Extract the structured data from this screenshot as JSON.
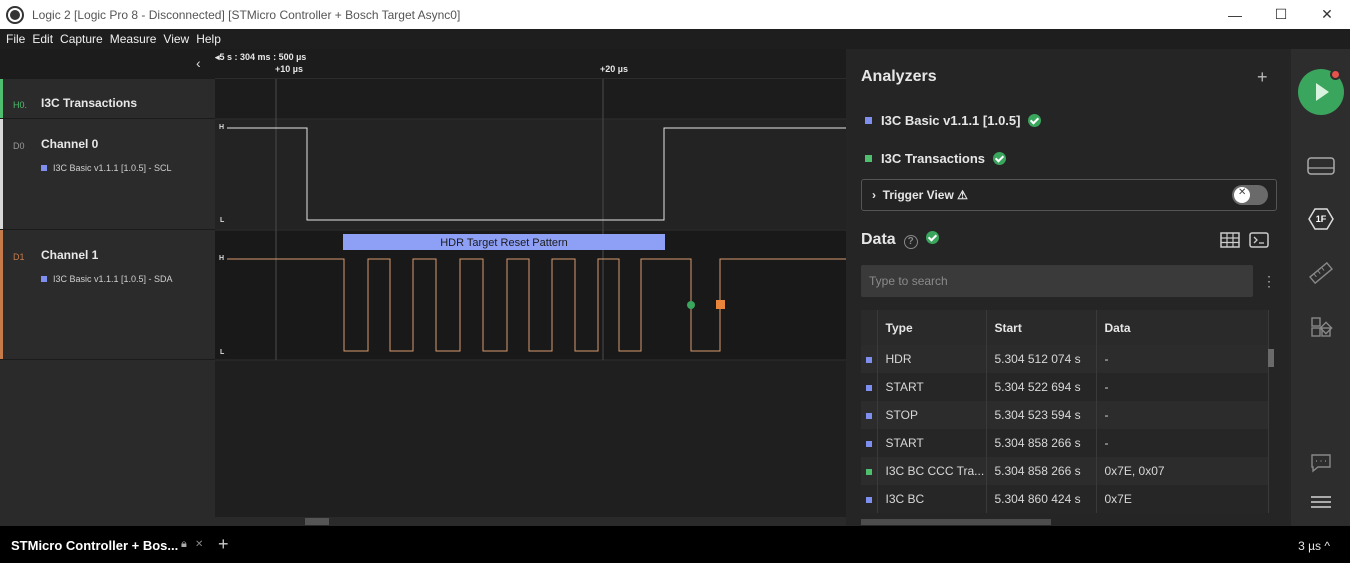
{
  "window": {
    "title": "Logic 2 [Logic Pro 8 - Disconnected] [STMicro Controller + Bosch Target Async0]",
    "minimize": "—",
    "maximize": "☐",
    "close": "✕"
  },
  "menu": [
    "File",
    "Edit",
    "Capture",
    "Measure",
    "View",
    "Help"
  ],
  "ruler": {
    "absolute": "5 s : 304 ms : 500 µs",
    "tick1": "+10 µs",
    "tick2": "+20 µs"
  },
  "channels": [
    {
      "tag": "H0.",
      "name": "I3C Transactions",
      "color": "#4fbf6f"
    },
    {
      "tag": "D0",
      "name": "Channel 0",
      "sub": "I3C Basic v1.1.1 [1.0.5] - SCL",
      "color": "#d8d8d8",
      "high": "H",
      "low": "L"
    },
    {
      "tag": "D1",
      "name": "Channel 1",
      "sub": "I3C Basic v1.1.1 [1.0.5] - SDA",
      "color": "#c77b4a",
      "high": "H",
      "low": "L"
    }
  ],
  "annotation": "HDR Target Reset Pattern",
  "analyzers": {
    "title": "Analyzers",
    "add": "+",
    "items": [
      {
        "name": "I3C Basic v1.1.1 [1.0.5]",
        "color": "#7f8ff0"
      },
      {
        "name": "I3C Transactions",
        "color": "#4fbf6f"
      }
    ],
    "trigger_view": "Trigger View",
    "warning": "⚠"
  },
  "data_panel": {
    "title": "Data",
    "help": "?",
    "search_placeholder": "Type to search",
    "more": "⋮",
    "columns": [
      "Type",
      "Start",
      "Data"
    ],
    "rows": [
      {
        "type": "HDR",
        "start": "5.304 512 074 s",
        "data": "-",
        "color": "#7f8ff0"
      },
      {
        "type": "START",
        "start": "5.304 522 694 s",
        "data": "-",
        "color": "#7f8ff0"
      },
      {
        "type": "STOP",
        "start": "5.304 523 594 s",
        "data": "-",
        "color": "#7f8ff0"
      },
      {
        "type": "START",
        "start": "5.304 858 266 s",
        "data": "-",
        "color": "#7f8ff0"
      },
      {
        "type": "I3C BC CCC Tra...",
        "start": "5.304 858 266 s",
        "data": "0x7E, 0x07",
        "color": "#4fbf6f"
      },
      {
        "type": "I3C BC",
        "start": "5.304 860 424 s",
        "data": "0x7E",
        "color": "#7f8ff0"
      }
    ]
  },
  "toolbar": {
    "icons": [
      "device-icon",
      "trigger-1f-icon",
      "measure-ruler-icon",
      "extensions-icon",
      "chat-icon",
      "menu-icon"
    ],
    "trigger_label": "1F"
  },
  "bottom": {
    "tab": "STMicro Controller + Bos...",
    "zoom": "3 µs ^"
  }
}
